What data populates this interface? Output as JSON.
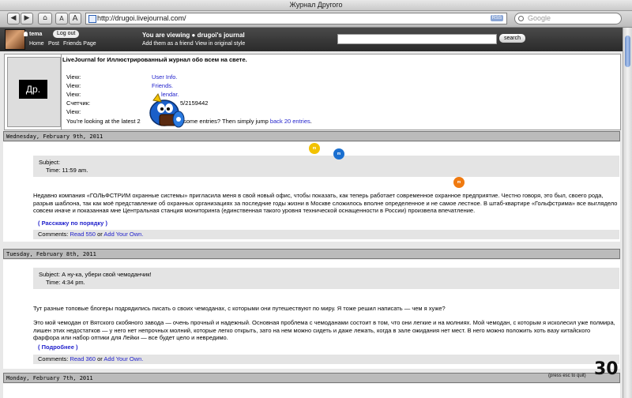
{
  "window": {
    "title": "Журнал Другого"
  },
  "toolbar": {
    "back": "◀",
    "forward": "▶",
    "home": "⌂",
    "font_small": "A",
    "font_large": "A",
    "url": "http://drugoi.livejournal.com/",
    "rss": "RSS",
    "search_placeholder": "Google"
  },
  "ljbar": {
    "username": "tema",
    "logout": "Log out",
    "nav": [
      "Home",
      "Post",
      "Friends Page"
    ],
    "viewing": "You are viewing ",
    "journal": "drugoi's journal",
    "add_friend": "Add them as a friend",
    "original_style": "View in original style",
    "search_button": "search"
  },
  "info": {
    "userpic_text": "Др.",
    "title": "LiveJournal for Иллюстрированный журнал обо всем на свете.",
    "rows": [
      {
        "label": "View:",
        "value": "User Info."
      },
      {
        "label": "View:",
        "value": "Friends."
      },
      {
        "label": "View:",
        "value": "lendar."
      },
      {
        "label": "Счетчик:",
        "value": "5/2159442"
      },
      {
        "label": "View:",
        "value": ""
      }
    ],
    "footer_pre": "You're looking at the latest 2",
    "footer_mid": "d some entries? Then simply jump ",
    "footer_link": "back 20 entries",
    "footer_post": "."
  },
  "entries": [
    {
      "date": "Wednesday, February 9th, 2011",
      "subject": "Subject:",
      "time": "Time: 11:59 am.",
      "text": "Недавно компания «ГОЛЬФСТРИМ охранные системы» пригласила меня в свой новый офис, чтобы показать, как теперь работает современное охранное предприятие. Честно говоря, это был, своего рода, разрыв шаблона, так как моё представление об охранных организациях за последние годы жизни в Москве сложилось вполне определенное и не самое лестное. В штаб-квартире «Гольфстрима» все выглядело совсем иначе и показанная мне Центральная станция мониторинга (единственная такого уровня технической оснащенности в России) произвела впечатление.",
      "more": "Расскажу по порядку",
      "comments_label": "Comments:",
      "read": "Read 550",
      "or": "or",
      "add": "Add Your Own."
    },
    {
      "date": "Tuesday, February 8th, 2011",
      "subject": "Subject: А ну-ка, убери свой чемоданчик!",
      "time": "Time: 4:34 pm.",
      "text1": "Тут разные топовые блогеры подрядились писать о своих чемоданах, с которыми они путешествуют по миру. Я тоже решил написать — чем я хуже?",
      "text2": "Это мой чемодан от Вятского скобяного завода — очень прочный и надежный. Основная проблема с чемоданами состоит в том, что они легкие и на молниях. Мой чемодан, с которым я исколесил уже полмира, лишен этих недостатков — у него нет непрочных молний, которые легко открыть, зато на нем можно сидеть и даже лежать, когда в зале ожидания нет мест. В него можно положить хоть вазу китайского фарфора или набор оптики для Лейки — все будет цело и невредимо.",
      "more": "Подробнее",
      "comments_label": "Comments:",
      "read": "Read 360",
      "or": "or",
      "add": "Add Your Own."
    },
    {
      "date": "Monday, February 7th, 2011"
    }
  ],
  "overlay": {
    "hint": "(press esc to quit)",
    "counter": "30",
    "candy_letter": "m"
  },
  "colors": {
    "link": "#2222cc",
    "band": "#bbbbbb",
    "candy_yellow": "#f2c200",
    "candy_blue": "#1a6fd0",
    "candy_orange": "#f07a10"
  }
}
